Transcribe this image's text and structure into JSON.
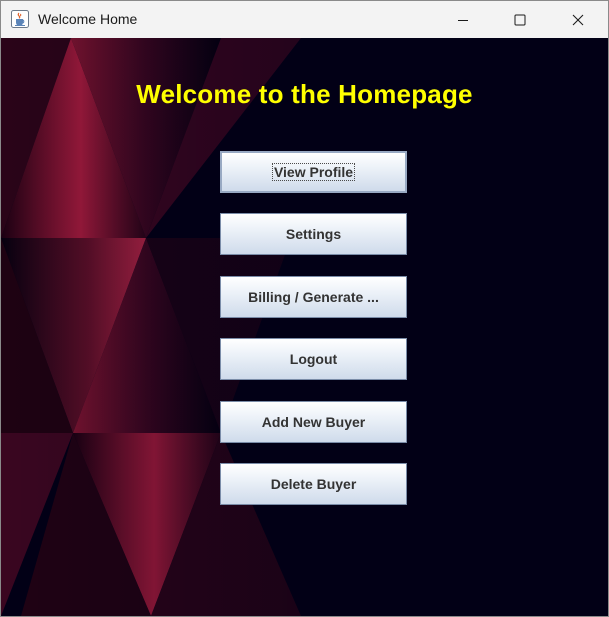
{
  "window": {
    "title": "Welcome Home",
    "app_icon": "java-cup-icon",
    "controls": [
      "minimize-icon",
      "maximize-icon",
      "close-icon"
    ]
  },
  "main": {
    "heading": "Welcome to the Homepage",
    "heading_color": "#ffff00",
    "background_color": "#020016",
    "accent_color": "#a01a3c",
    "buttons": [
      {
        "label": "View Profile",
        "focused": true
      },
      {
        "label": "Settings"
      },
      {
        "label": "Billing / Generate ..."
      },
      {
        "label": "Logout"
      },
      {
        "label": "Add New Buyer"
      },
      {
        "label": "Delete Buyer"
      }
    ]
  }
}
